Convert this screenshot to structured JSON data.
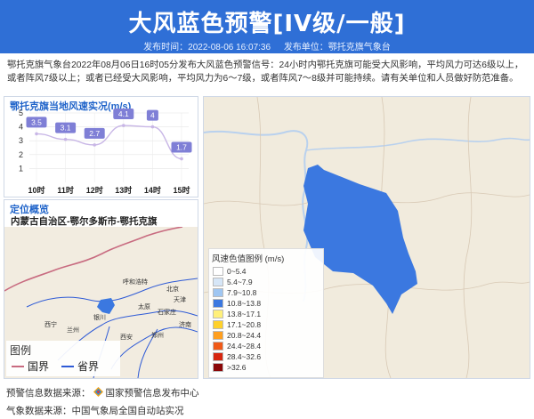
{
  "header": {
    "title": "大风蓝色预警[IV级/一般]",
    "publish_time_label": "发布时间：2022-08-06 16:07:36",
    "publish_unit_label": "发布单位：鄂托克旗气象台"
  },
  "description": "鄂托克旗气象台2022年08月06日16时05分发布大风蓝色预警信号：24小时内鄂托克旗可能受大风影响，平均风力可达6级以上，或者阵风7级以上；或者已经受大风影响，平均风力为6～7级，或者阵风7～8级并可能持续。请有关单位和人员做好防范准备。",
  "wind_panel": {
    "title": "鄂托克旗当地风速实况(m/s)"
  },
  "chart_data": {
    "type": "line",
    "categories": [
      "10时",
      "11时",
      "12时",
      "13时",
      "14时",
      "15时"
    ],
    "values": [
      3.5,
      3.1,
      2.7,
      4.1,
      4.0,
      1.7
    ],
    "value_labels": [
      "3.5",
      "3.1",
      "2.7",
      "4.1",
      "4",
      "1.7"
    ],
    "ylim": [
      0,
      5
    ],
    "yticks": [
      "1",
      "2",
      "3",
      "4",
      "5"
    ],
    "title": "鄂托克旗当地风速实况(m/s)",
    "colors": {
      "line": "#c8b6e6",
      "label_box": "#7f7fd6"
    }
  },
  "location_panel": {
    "title": "定位概览",
    "region": "内蒙古自治区-鄂尔多斯市-鄂托克旗",
    "legend_title": "图例",
    "legend_items": [
      {
        "label": "国界",
        "color": "#c86b80"
      },
      {
        "label": "省界",
        "color": "#2f5bd6"
      }
    ],
    "place_labels": [
      "呼和浩特",
      "北京",
      "天津",
      "太原",
      "石家庄",
      "济南",
      "银川",
      "兰州",
      "西宁",
      "郑州",
      "西安"
    ]
  },
  "map_legend": {
    "title": "风速色值图例 (m/s)",
    "items": [
      {
        "label": "0~5.4",
        "color": "#ffffff"
      },
      {
        "label": "5.4~7.9",
        "color": "#d6e6f7"
      },
      {
        "label": "7.9~10.8",
        "color": "#9fc6f2"
      },
      {
        "label": "10.8~13.8",
        "color": "#3b78e0"
      },
      {
        "label": "13.8~17.1",
        "color": "#fff07a"
      },
      {
        "label": "17.1~20.8",
        "color": "#ffd12a"
      },
      {
        "label": "20.8~24.4",
        "color": "#ff9f1f"
      },
      {
        "label": "24.4~28.4",
        "color": "#f05a17"
      },
      {
        "label": "28.4~32.6",
        "color": "#d6260f"
      },
      {
        "label": ">32.6",
        "color": "#8a0707"
      }
    ]
  },
  "footer": {
    "source1_label": "预警信息数据来源：",
    "source1_name": "国家预警信息发布中心",
    "source2": "气象数据来源：中国气象局全国自动站实况"
  },
  "colors": {
    "header_bg": "#2f6fd6",
    "warning_area": "#3b78e0"
  }
}
